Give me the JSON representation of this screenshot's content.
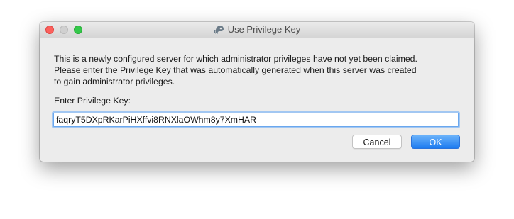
{
  "window": {
    "title": "Use Privilege Key",
    "title_icon": "teamspeak-icon"
  },
  "message": {
    "lines": [
      "This is a newly configured server for which administrator privileges have not yet been claimed.",
      "Please enter the Privilege Key that was automatically generated when this server was created",
      "to gain administrator privileges."
    ]
  },
  "privilege_key": {
    "label": "Enter Privilege Key:",
    "value": "faqryT5DXpRKarPiHXffvi8RNXlaOWhm8y7XmHAR"
  },
  "buttons": {
    "cancel_label": "Cancel",
    "ok_label": "OK"
  },
  "colors": {
    "close": "#fc605c",
    "minimize": "#d0d0d0",
    "zoom": "#34c84a",
    "accent": "#1d7bf0"
  }
}
